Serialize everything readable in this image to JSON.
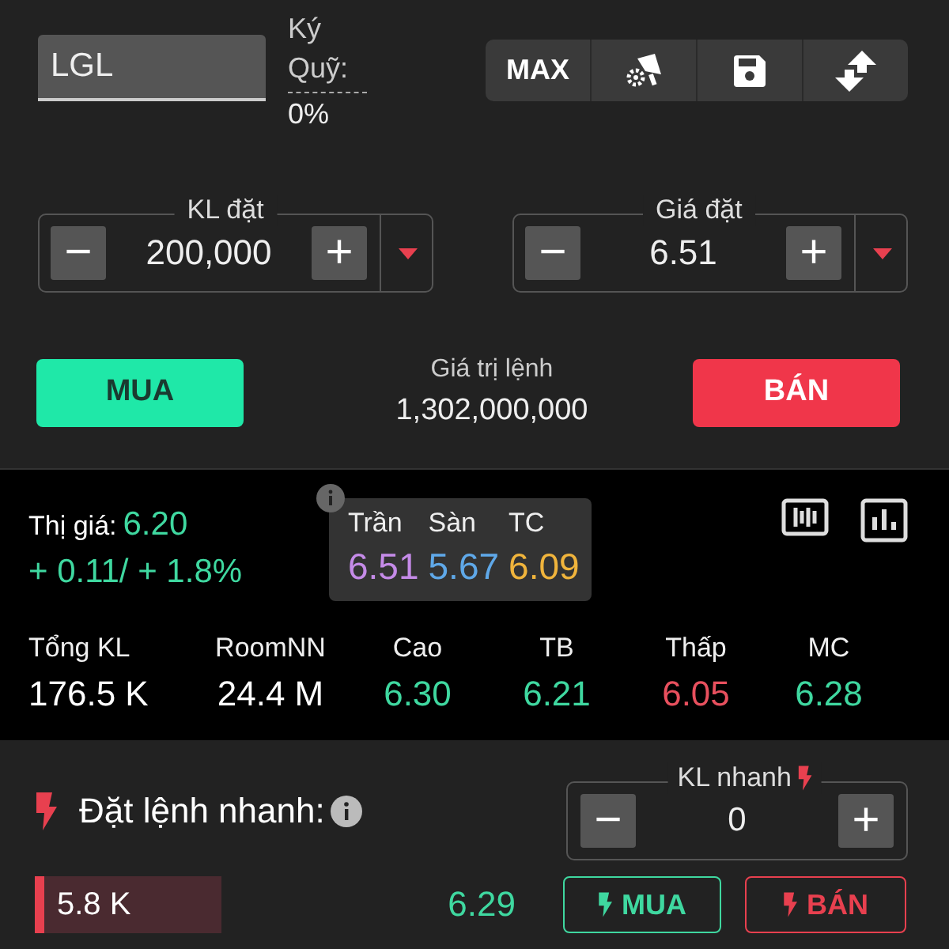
{
  "symbol_field": {
    "value": "LGL"
  },
  "margin": {
    "label": "Ký Quỹ:",
    "value": "0%"
  },
  "toolbar": {
    "max_label": "MAX"
  },
  "quantity": {
    "label": "KL đặt",
    "value": "200,000",
    "minus": "−",
    "plus": "+"
  },
  "price": {
    "label": "Giá đặt",
    "value": "6.51",
    "minus": "−",
    "plus": "+"
  },
  "buy_button": "MUA",
  "order_value": {
    "label": "Giá trị lệnh",
    "value": "1,302,000,000"
  },
  "sell_button": "BÁN",
  "market_price": {
    "label": "Thị giá:",
    "value": "6.20",
    "change": "+ 0.11/ + 1.8%"
  },
  "price_limits": [
    {
      "label": "Trần",
      "value": "6.51",
      "color": "#c58be8"
    },
    {
      "label": "Sàn",
      "value": "5.67",
      "color": "#5fa8e8"
    },
    {
      "label": "TC",
      "value": "6.09",
      "color": "#f0b43c"
    }
  ],
  "stats": [
    {
      "label": "Tổng KL",
      "value": "176.5 K",
      "color": "#ffffff"
    },
    {
      "label": "RoomNN",
      "value": "24.4 M",
      "color": "#ffffff"
    },
    {
      "label": "Cao",
      "value": "6.30",
      "color": "#3fd8a0"
    },
    {
      "label": "TB",
      "value": "6.21",
      "color": "#3fd8a0"
    },
    {
      "label": "Thấp",
      "value": "6.05",
      "color": "#e8505e"
    },
    {
      "label": "MC",
      "value": "6.28",
      "color": "#3fd8a0"
    }
  ],
  "quick_order": {
    "title": "Đặt lệnh nhanh:",
    "quantity_label": "KL nhanh",
    "quantity": "0",
    "minus": "−",
    "plus": "+"
  },
  "quick_rows": [
    {
      "volume": "5.8 K",
      "level": 0.05,
      "price": "6.29",
      "buy": "MUA",
      "sell": "BÁN"
    }
  ]
}
